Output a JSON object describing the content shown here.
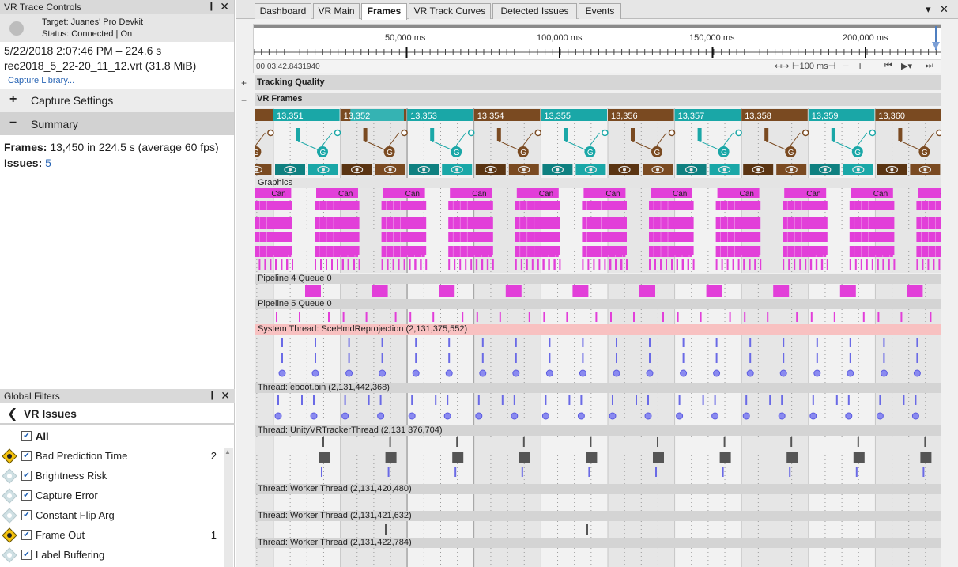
{
  "left_panel": {
    "title": "VR Trace Controls",
    "pin": "❙",
    "close": "✕",
    "target": "Target: Juanes' Pro Devkit",
    "status": "Status: Connected | On",
    "capture_time": "5/22/2018 2:07:46 PM – 224.6 s",
    "capture_file": "rec2018_5_22-20_11_12.vrt (31.8 MiB)",
    "library_link": "Capture Library...",
    "capture_settings": {
      "symbol": "+",
      "label": "Capture Settings"
    },
    "summary": {
      "symbol": "−",
      "label": "Summary"
    },
    "frames_label": "Frames:",
    "frames_value": "13,450 in 224.5 s (average 60 fps)",
    "issues_label": "Issues:",
    "issues_value": "5"
  },
  "filters": {
    "title": "Global Filters",
    "back": "❮",
    "heading": "VR Issues",
    "all_label": "All",
    "check": "✔",
    "items": [
      {
        "label": "Bad Prediction Time",
        "count": "2",
        "active": true
      },
      {
        "label": "Brightness Risk",
        "count": "",
        "active": false
      },
      {
        "label": "Capture Error",
        "count": "",
        "active": false
      },
      {
        "label": "Constant Flip Arg",
        "count": "",
        "active": false
      },
      {
        "label": "Frame Out",
        "count": "1",
        "active": true
      },
      {
        "label": "Label Buffering",
        "count": "",
        "active": false
      }
    ]
  },
  "tabs": [
    "Dashboard",
    "VR Main",
    "Frames",
    "VR Track Curves",
    "Detected Issues",
    "Events"
  ],
  "tab_controls": {
    "menu": "▾",
    "close": "✕"
  },
  "ruler": {
    "labels": [
      "50,000 ms",
      "100,000 ms",
      "150,000 ms",
      "200,000 ms"
    ],
    "timecode": "00:03:42.8431940",
    "zoom_label": "100 ms"
  },
  "groups": {
    "tracking_quality": {
      "symbol": "+",
      "label": "Tracking Quality"
    },
    "vr_frames": {
      "symbol": "−",
      "label": "VR Frames"
    }
  },
  "frames": [
    "13,351",
    "13,352",
    "13,353",
    "13,354",
    "13,355",
    "13,356",
    "13,357",
    "13,358",
    "13,359",
    "13,360"
  ],
  "g_marker": "G",
  "graphics_label": "Graphics",
  "can_label": "Can",
  "lanes": {
    "pipeline4": "Pipeline 4 Queue 0",
    "pipeline5": "Pipeline 5 Queue 0",
    "system_thread": "System Thread: SceHmdReprojection (2,131,375,552)",
    "eboot": "Thread: eboot.bin (2,131,442,368)",
    "unity_tracker": "Thread: UnityVRTrackerThread (2,131 376,704)",
    "worker1": "Thread: Worker Thread (2,131,420,480)",
    "worker2": "Thread: Worker Thread (2,131,421,632)",
    "worker3": "Thread: Worker Thread (2,131,422,784)"
  },
  "colors": {
    "teal": "#1aa7a7",
    "brown": "#7a4a21",
    "magenta": "#e23fd9",
    "purple": "#6a6ae6",
    "highlight_pink": "#f8c1c1"
  }
}
